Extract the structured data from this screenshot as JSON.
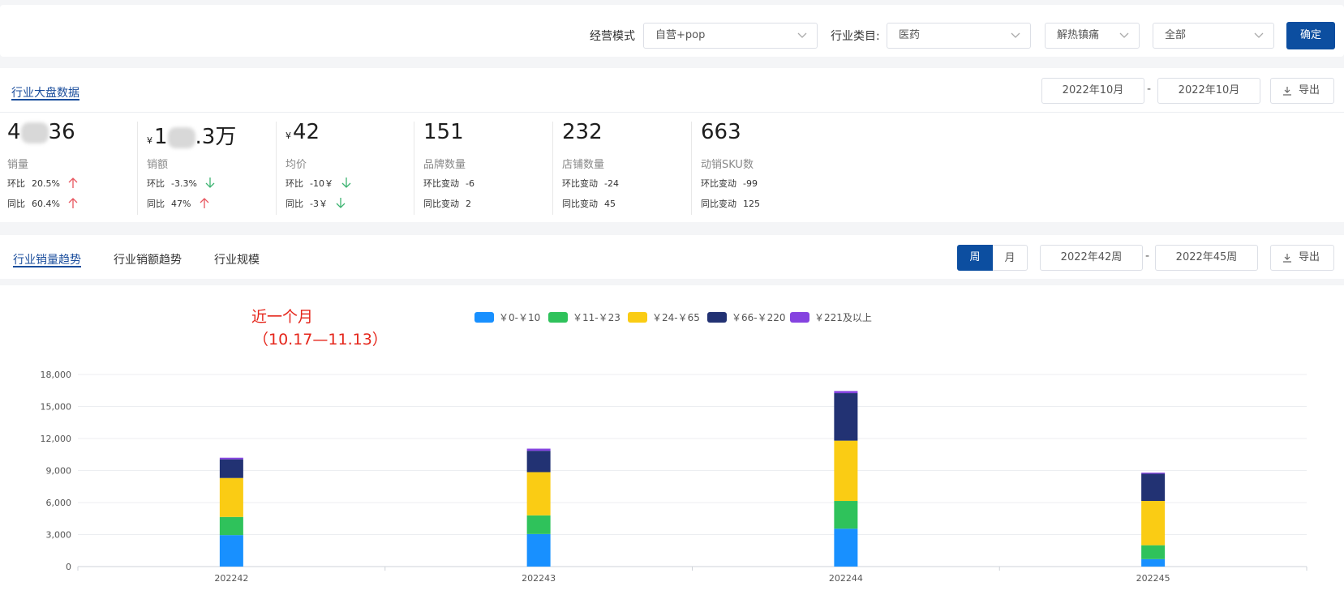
{
  "filters": {
    "mode_label": "经营模式",
    "mode_value": "自营+pop",
    "industry_label": "行业类目:",
    "industry_value": "医药",
    "sub_value": "解热镇痛",
    "all_value": "全部",
    "confirm_label": "确定"
  },
  "overview": {
    "tab_label": "行业大盘数据",
    "date_from": "2022年10月",
    "date_to": "2022年10月",
    "dash": "-",
    "export_label": "导出",
    "metrics": [
      {
        "value_prefix": "4",
        "value_suffix": "36",
        "label": "销量",
        "row1_label": "环比",
        "row1_value": "20.5%",
        "row1_dir": "up",
        "row2_label": "同比",
        "row2_value": "60.4%",
        "row2_dir": "up"
      },
      {
        "currency": "¥",
        "value_prefix": "1",
        "value_suffix": ".3万",
        "label": "销额",
        "row1_label": "环比",
        "row1_value": "-3.3%",
        "row1_dir": "down",
        "row2_label": "同比",
        "row2_value": "47%",
        "row2_dir": "up"
      },
      {
        "currency": "¥",
        "value": "42",
        "label": "均价",
        "row1_label": "环比",
        "row1_value": "-10￥",
        "row1_dir": "down",
        "row2_label": "同比",
        "row2_value": "-3￥",
        "row2_dir": "down"
      },
      {
        "value": "151",
        "label": "品牌数量",
        "row1_label": "环比变动",
        "row1_value": "-6",
        "row2_label": "同比变动",
        "row2_value": "2"
      },
      {
        "value": "232",
        "label": "店铺数量",
        "row1_label": "环比变动",
        "row1_value": "-24",
        "row2_label": "同比变动",
        "row2_value": "45"
      },
      {
        "value": "663",
        "label": "动销SKU数",
        "row1_label": "环比变动",
        "row1_value": "-99",
        "row2_label": "同比变动",
        "row2_value": "125"
      }
    ]
  },
  "trend": {
    "tabs": [
      "行业销量趋势",
      "行业销额趋势",
      "行业规模"
    ],
    "week_label": "周",
    "month_label": "月",
    "date_from": "2022年42周",
    "date_to": "2022年45周",
    "dash": "-",
    "export_label": "导出"
  },
  "annotation": {
    "line1": "近一个月",
    "line2": "（10.17—11.13）"
  },
  "colors": {
    "accent": "#0c4ea0",
    "up": "#e8565f",
    "down": "#3cb371"
  },
  "chart_data": {
    "type": "bar",
    "stacked": true,
    "categories": [
      "202242",
      "202243",
      "202244",
      "202245"
    ],
    "series": [
      {
        "name": "￥0-￥10",
        "color": "#1890ff",
        "values": [
          2950,
          3050,
          3550,
          700
        ]
      },
      {
        "name": "￥11-￥23",
        "color": "#2fc25b",
        "values": [
          1700,
          1750,
          2600,
          1300
        ]
      },
      {
        "name": "￥24-￥65",
        "color": "#facc14",
        "values": [
          3650,
          4050,
          5650,
          4150
        ]
      },
      {
        "name": "￥66-￥220",
        "color": "#223273",
        "values": [
          1750,
          2000,
          4450,
          2550
        ]
      },
      {
        "name": "￥221及以上",
        "color": "#8543e0",
        "values": [
          150,
          200,
          200,
          100
        ]
      }
    ],
    "yticks": [
      "0",
      "3,000",
      "6,000",
      "9,000",
      "12,000",
      "15,000",
      "18,000"
    ],
    "ylim": [
      0,
      18000
    ],
    "grid": true,
    "legend": "top-center"
  }
}
